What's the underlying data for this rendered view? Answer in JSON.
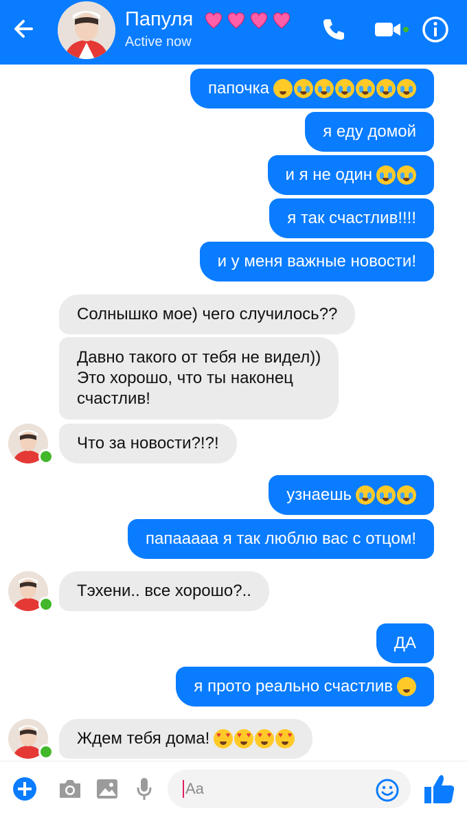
{
  "header": {
    "contact_name": "Папуля",
    "status": "Active now",
    "hearts": [
      "heart",
      "heart",
      "heart",
      "heart"
    ]
  },
  "messages": [
    {
      "dir": "out",
      "text": "папочка",
      "emoji": [
        "sneeze",
        "cry",
        "cry",
        "cry",
        "cry",
        "cry",
        "cry"
      ]
    },
    {
      "dir": "out",
      "text": "я еду домой"
    },
    {
      "dir": "out",
      "text": "и я не один",
      "emoji": [
        "cry",
        "cry"
      ]
    },
    {
      "dir": "out",
      "text": "я так счастлив!!!!"
    },
    {
      "dir": "out",
      "text": "и у меня важные новости!"
    },
    {
      "dir": "in",
      "text": "Солнышко мое) чего случилось??"
    },
    {
      "dir": "in",
      "lines": [
        "Давно такого от тебя не видел))",
        "Это хорошо, что ты наконец",
        "счастлив!"
      ]
    },
    {
      "dir": "in",
      "text": "Что за новости?!?!"
    },
    {
      "dir": "out",
      "text": "узнаешь",
      "emoji": [
        "cry",
        "cry",
        "cry"
      ]
    },
    {
      "dir": "out",
      "text": "папааааа я так люблю вас с отцом!"
    },
    {
      "dir": "in",
      "text": "Тэхени.. все хорошо?.."
    },
    {
      "dir": "out",
      "text": "ДА"
    },
    {
      "dir": "out",
      "text": "я прото реально счастлив",
      "emoji": [
        "sneeze"
      ]
    },
    {
      "dir": "in",
      "text": "Ждем тебя дома!",
      "emoji": [
        "heart-eyes",
        "heart-eyes",
        "heart-eyes",
        "heart-eyes"
      ]
    }
  ],
  "composer": {
    "placeholder": "Aa"
  },
  "colors": {
    "accent": "#0a7cff",
    "incoming_bubble": "#ebebeb",
    "online": "#42b72a"
  },
  "icons": [
    "back-arrow-icon",
    "phone-icon",
    "video-camera-icon",
    "info-icon",
    "plus-icon",
    "camera-icon",
    "image-icon",
    "microphone-icon",
    "smiley-icon",
    "thumbs-up-icon"
  ]
}
